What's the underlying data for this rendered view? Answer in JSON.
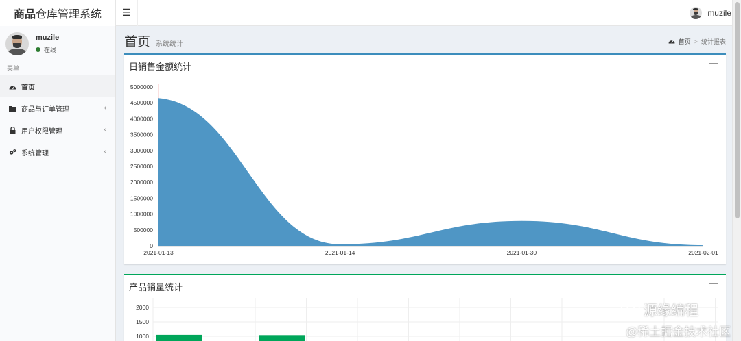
{
  "app": {
    "title_bold": "商品",
    "title_rest": "仓库管理系统"
  },
  "topbar": {
    "toggle_icon": "hamburger-icon",
    "user_name": "muzile"
  },
  "sidebar": {
    "user_name": "muzile",
    "status": "在线",
    "status_color": "#2e7d32",
    "menu_header": "菜单",
    "items": [
      {
        "label": "首页",
        "icon": "dashboard-icon",
        "active": true
      },
      {
        "label": "商品与订单管理",
        "icon": "folder-icon",
        "expandable": true
      },
      {
        "label": "用户权限管理",
        "icon": "lock-icon",
        "expandable": true
      },
      {
        "label": "系统管理",
        "icon": "gears-icon",
        "expandable": true
      }
    ]
  },
  "header": {
    "title": "首页",
    "subtitle": "系统统计",
    "breadcrumb": {
      "home": "首页",
      "current": "统计报表"
    }
  },
  "colors": {
    "primary": "#3c8dbc",
    "success": "#00a65a",
    "area_fill": "#4f96c5",
    "bar_fill": "#00a65a"
  },
  "chart_data": [
    {
      "type": "area",
      "title": "日销售金额统计",
      "x": [
        "2021-01-13",
        "2021-01-14",
        "2021-01-30",
        "2021-02-01"
      ],
      "values": [
        4650000,
        50000,
        780000,
        20000
      ],
      "ylim": [
        0,
        5000000
      ],
      "yticks": [
        "5000000",
        "4500000",
        "4000000",
        "3500000",
        "3000000",
        "2500000",
        "2000000",
        "1500000",
        "1000000",
        "500000",
        "0"
      ],
      "smooth": true,
      "grid": false
    },
    {
      "type": "bar",
      "title": "产品销量统计",
      "yticks": [
        "2000",
        "1500",
        "1000"
      ],
      "ylim": [
        0,
        2000
      ],
      "values": [
        1050,
        null,
        1040
      ],
      "grid": true
    }
  ],
  "watermark": {
    "line1": "源缘编程",
    "line2": "@稀土掘金技术社区"
  }
}
